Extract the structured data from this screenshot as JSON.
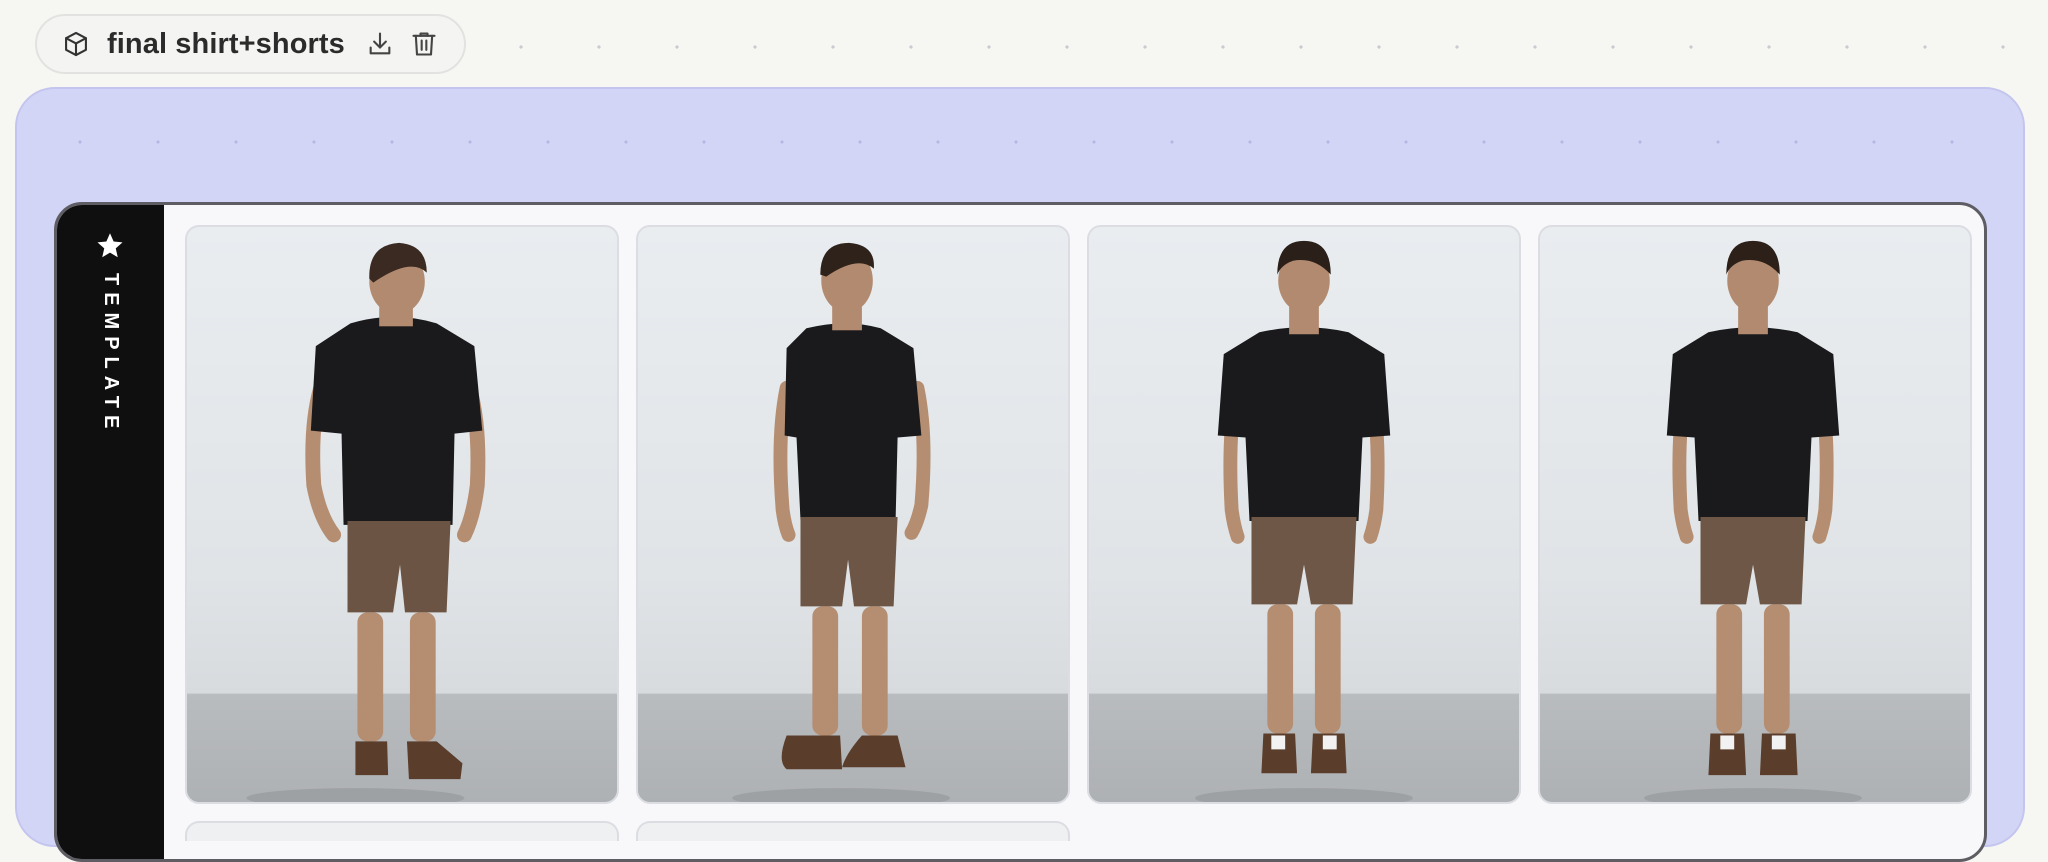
{
  "canvas_item": {
    "title": "final shirt+shorts",
    "icon": "cube-icon",
    "actions": [
      {
        "name": "download",
        "icon": "download-icon"
      },
      {
        "name": "delete",
        "icon": "trash-icon"
      }
    ]
  },
  "group": {
    "label": "TEMPLATE",
    "icon": "star-icon",
    "colors": {
      "frame": "#d3d5f6",
      "sidebar": "#0f0f10",
      "card": "#f8f8fa"
    }
  },
  "photos": [
    {
      "name": "model-back-view",
      "pose": "back",
      "subject": "man in black t-shirt and brown shorts"
    },
    {
      "name": "model-side-view",
      "pose": "three-quarter",
      "subject": "man in black t-shirt and brown shorts"
    },
    {
      "name": "model-front-view",
      "pose": "front",
      "subject": "man in black t-shirt and brown shorts"
    },
    {
      "name": "model-front-view-2",
      "pose": "front",
      "subject": "man in black t-shirt and brown shorts"
    }
  ]
}
